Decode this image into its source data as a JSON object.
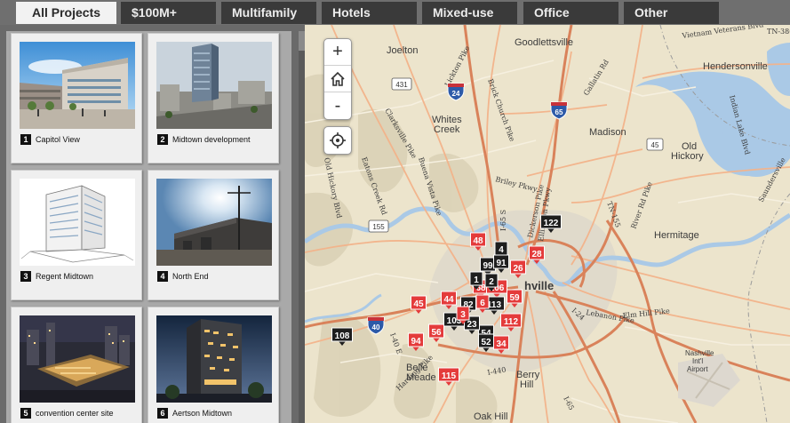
{
  "tabs": [
    {
      "label": "All Projects",
      "active": true
    },
    {
      "label": "$100M+"
    },
    {
      "label": "Multifamily"
    },
    {
      "label": "Hotels"
    },
    {
      "label": "Mixed-use"
    },
    {
      "label": "Office"
    },
    {
      "label": "Other"
    }
  ],
  "projects": [
    {
      "num": "1",
      "title": "Capitol View"
    },
    {
      "num": "2",
      "title": "Midtown development"
    },
    {
      "num": "3",
      "title": "Regent Midtown"
    },
    {
      "num": "4",
      "title": "North End"
    },
    {
      "num": "5",
      "title": "convention center site"
    },
    {
      "num": "6",
      "title": "Aertson Midtown"
    }
  ],
  "map_controls": {
    "zoom_in": "+",
    "home": "home-icon",
    "zoom_out": "-",
    "locate": "locate-icon"
  },
  "map_labels": {
    "goodlettsville": "Goodlettsville",
    "joelton": "Joelton",
    "hendersonville": "Hendersonville",
    "whites_creek_1": "Whites",
    "whites_creek_2": "Creek",
    "madison": "Madison",
    "old_hickory_1": "Old",
    "old_hickory_2": "Hickory",
    "hermitage": "Hermitage",
    "nashville": "hville",
    "belle_meade_1": "Belle",
    "belle_meade_2": "Meade",
    "berry_hill_1": "Berry",
    "berry_hill_2": "Hill",
    "oak_hill": "Oak Hill",
    "airport_1": "Nashville",
    "airport_2": "Int'l",
    "airport_3": "Airport"
  },
  "road_labels": {
    "lickton": "Lickton Pike",
    "gallatin": "Gallatin Rd",
    "brick_church": "Brick Church Pike",
    "veterans": "Vietnam Veterans Blvd",
    "tn386": "TN-386",
    "indian_lake": "Indian Lake Blvd",
    "saundersville": "Saundersville",
    "clarksville": "Clarksville Pike",
    "eatons_creek": "Eatons Creek Rd",
    "buena_vista": "Buena Vista Pike",
    "old_hickory_blvd": "Old Hickory Blvd",
    "briley": "Briley Pkwy",
    "dickerson": "Dickerson Pike",
    "ellington": "Ellington Pkwy",
    "i65_n": "I-65 S",
    "tn155": "TN-155",
    "mcgavock": "McGavock Pike",
    "river_rd": "River Rd Pike",
    "lebanon": "Lebanon Pike",
    "elm_hill": "Elm Hill Pike",
    "hwy_i40": "I-40 E",
    "harding": "Harding Pike",
    "i440": "I-440",
    "i65_s": "I-65",
    "i24": "I-24"
  },
  "shields": {
    "i24": "24",
    "i65": "65",
    "i40": "40",
    "us431": "431",
    "us45": "45",
    "us155": "155"
  },
  "markers": [
    {
      "num": "48",
      "color": "red"
    },
    {
      "num": "4",
      "color": "black"
    },
    {
      "num": "122",
      "color": "black"
    },
    {
      "num": "28",
      "color": "red"
    },
    {
      "num": "99",
      "color": "black"
    },
    {
      "num": "91",
      "color": "black"
    },
    {
      "num": "26",
      "color": "red"
    },
    {
      "num": "68",
      "color": "red"
    },
    {
      "num": "106",
      "color": "red"
    },
    {
      "num": "44",
      "color": "red"
    },
    {
      "num": "82",
      "color": "black"
    },
    {
      "num": "113",
      "color": "black"
    },
    {
      "num": "59",
      "color": "red"
    },
    {
      "num": "45",
      "color": "red"
    },
    {
      "num": "103",
      "color": "black"
    },
    {
      "num": "112",
      "color": "red"
    },
    {
      "num": "56",
      "color": "red"
    },
    {
      "num": "54",
      "color": "black"
    },
    {
      "num": "52",
      "color": "black"
    },
    {
      "num": "34",
      "color": "red"
    },
    {
      "num": "108",
      "color": "black"
    },
    {
      "num": "94",
      "color": "red"
    },
    {
      "num": "115",
      "color": "red"
    },
    {
      "num": "23",
      "color": "black"
    },
    {
      "num": "6",
      "color": "red"
    },
    {
      "num": "1",
      "color": "black"
    },
    {
      "num": "2",
      "color": "black"
    },
    {
      "num": "3",
      "color": "red"
    }
  ],
  "colors": {
    "marker_red": "#e43b3b",
    "marker_black": "#1e1e1e",
    "tab_bg": "#3a3a3a",
    "tab_active_bg": "#f2f2f2",
    "map_land": "#ece4cc",
    "water": "#aac9e6"
  }
}
